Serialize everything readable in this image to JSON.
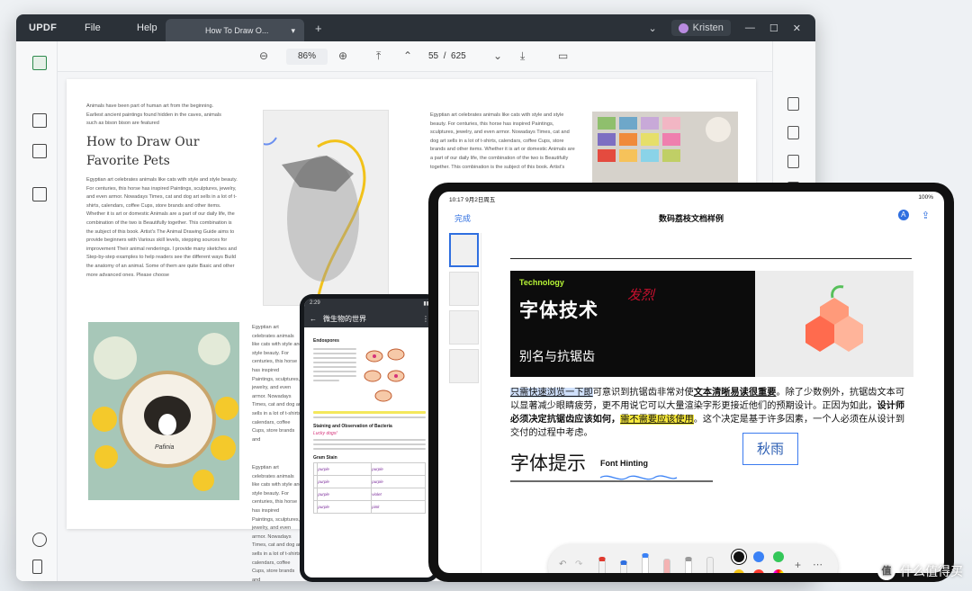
{
  "desktop": {
    "logo": "UPDF",
    "menu": [
      "File",
      "Help"
    ],
    "tab_title": "How To Draw O...",
    "tab_menu_icon": "chevron-down-icon",
    "new_tab": "+",
    "user": "Kristen",
    "zoom": "86%",
    "page_current": "55",
    "page_sep": "/",
    "page_total": "625",
    "doc_title_line1": "How to Draw Our",
    "doc_title_line2": "Favorite Pets",
    "col1_intro": "Animals have been part of human art from the beginning. Earliest ancient paintings found hidden in the caves, animals such as bison bison are featured",
    "col1_body": "Egyptian art celebrates animals like cats with style and style beauty. For centuries, this horse has inspired Paintings, sculptures, jewelry, and even armor. Nowadays Times, cat and dog art sells in a lot of t-shirts, calendars, coffee Cups, store brands and other items. Whether it is art or domestic Animals are a part of our daily life, the combination of the two is Beautifully together. This combination is the subject of this book. Artist's The Animal Drawing Guide aims to provide beginners with Various skill levels, stepping sources for improvement Their animal renderings. I provide many sketches and Step-by-step examples to help readers see the different ways Build the anatomy of an animal. Some of them are quite Basic and other more advanced ones. Please choose",
    "col2_body": "Egyptian art celebrates animals like cats with style and style beauty. For centuries, this horse has inspired Paintings, sculptures, jewelry, and even armor. Nowadays Times, cat and dog art sells in a lot of t-shirts, calendars, coffee Cups, store brands and",
    "col2_body2": "Egyptian art celebrates animals like cats with style and style beauty. For centuries, this horse has inspired Paintings, sculptures, jewelry, and even armor. Nowadays Times, cat and dog art sells in a lot of t-shirts, calendars, coffee Cups, store brands and",
    "col3_body": "Egyptian art celebrates animals like cats with style and style beauty. For centuries, this horse has inspired Paintings, sculptures, jewelry, and even armor. Nowadays Times, cat and dog art sells in a lot of t-shirts, calendars, coffee Cups, store brands and other items. Whether it is art or domestic Animals are a part of our daily life, the combination of the two is Beautifully together. This combination is the subject of this book. Artist's",
    "lens_caption": "Pafinia"
  },
  "phone": {
    "time": "2:29",
    "title": "微生物的世界",
    "h1": "Endospores",
    "h2": "Staining and Observation of Bacteria",
    "h3": "Gram Stain",
    "handwriting_note": "Lucky dogs!",
    "table_rows": [
      [
        "purple",
        "purple"
      ],
      [
        "purple",
        "purple"
      ],
      [
        "purple",
        "violet"
      ],
      [
        "purple",
        "pink"
      ]
    ]
  },
  "tablet": {
    "time": "10:17",
    "date": "9月2日周五",
    "battery": "100%",
    "done": "完成",
    "title": "数码荔枝文档样例",
    "banner_tag": "Technology",
    "banner_title": "字体技术",
    "banner_handwriting": "发烈",
    "banner_sub": "别名与抗锯齿",
    "para_a": "只需快速浏览一下即",
    "para_b": "可意识到抗锯齿非常对使",
    "para_c": "文本清晰易读很重要",
    "para_d": "。除了少数例外，抗锯齿文本可以显著减少眼睛疲劳，更不用说它可以大量渲染字形更接近他们的预期设计。正因为如此，",
    "para_e": "设计师必须决定抗锯齿应该如何，",
    "para_f": "需不需要应该使用",
    "para_g": "。这个决定是基于许多因素，一个人必须在从设计到交付的过程中考虑。",
    "hint_title": "字体提示",
    "hint_en": "Font Hinting",
    "signature": "秋雨",
    "colors": [
      "#111111",
      "#3b82f6",
      "#34c759",
      "#f5c518",
      "#ff3b30",
      "#c86bff"
    ]
  },
  "watermark": "什么值得买"
}
